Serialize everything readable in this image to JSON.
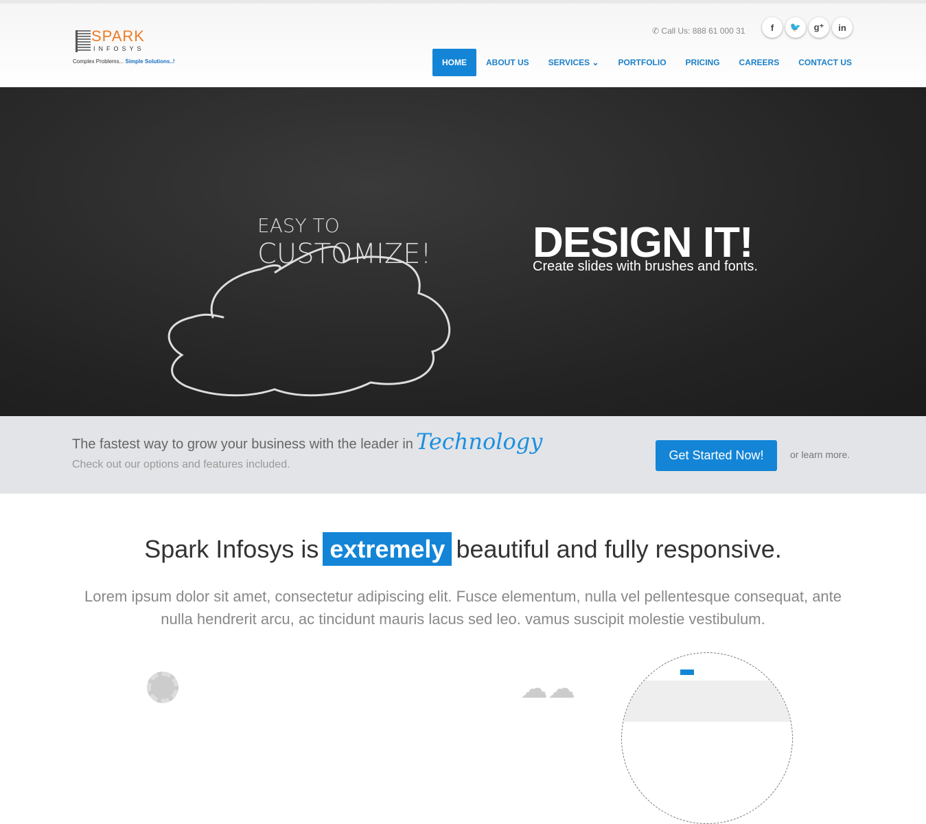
{
  "brand": {
    "name": "SPARK",
    "sub": "INFOSYS",
    "tagline_a": "Complex Problems...",
    "tagline_b": "Simple Solutions..!",
    "accent": "#f07a22"
  },
  "header": {
    "call": "Call Us: 888 61 000 31",
    "social": [
      {
        "icon": "facebook-icon",
        "glyph": "f"
      },
      {
        "icon": "twitter-icon",
        "glyph": "🐦"
      },
      {
        "icon": "google-plus-icon",
        "glyph": "g⁺"
      },
      {
        "icon": "linkedin-icon",
        "glyph": "in"
      }
    ]
  },
  "nav": [
    {
      "label": "HOME",
      "active": true
    },
    {
      "label": "ABOUT US"
    },
    {
      "label": "SERVICES ⌄"
    },
    {
      "label": "PORTFOLIO"
    },
    {
      "label": "PRICING"
    },
    {
      "label": "CAREERS"
    },
    {
      "label": "CONTACT US"
    }
  ],
  "hero": {
    "cloud_line1": "EASY TO",
    "cloud_line2": "CUSTOMIZE!",
    "title": "DESIGN IT!",
    "subtitle": "Create slides with brushes and fonts."
  },
  "band": {
    "text": "The fastest way to grow your business with the leader in",
    "highlight": "Technology",
    "sub": "Check out our options and features included.",
    "button": "Get Started Now!",
    "learn": "or learn more."
  },
  "intro": {
    "pre": "Spark Infosys is",
    "highlight": "extremely",
    "post": "beautiful and fully responsive.",
    "body": "Lorem ipsum dolor sit amet, consectetur adipiscing elit. Fusce elementum, nulla vel pellentesque consequat, ante nulla hendrerit arcu, ac tincidunt mauris lacus sed leo. vamus suscipit molestie vestibulum."
  },
  "colors": {
    "primary": "#1485d6"
  }
}
